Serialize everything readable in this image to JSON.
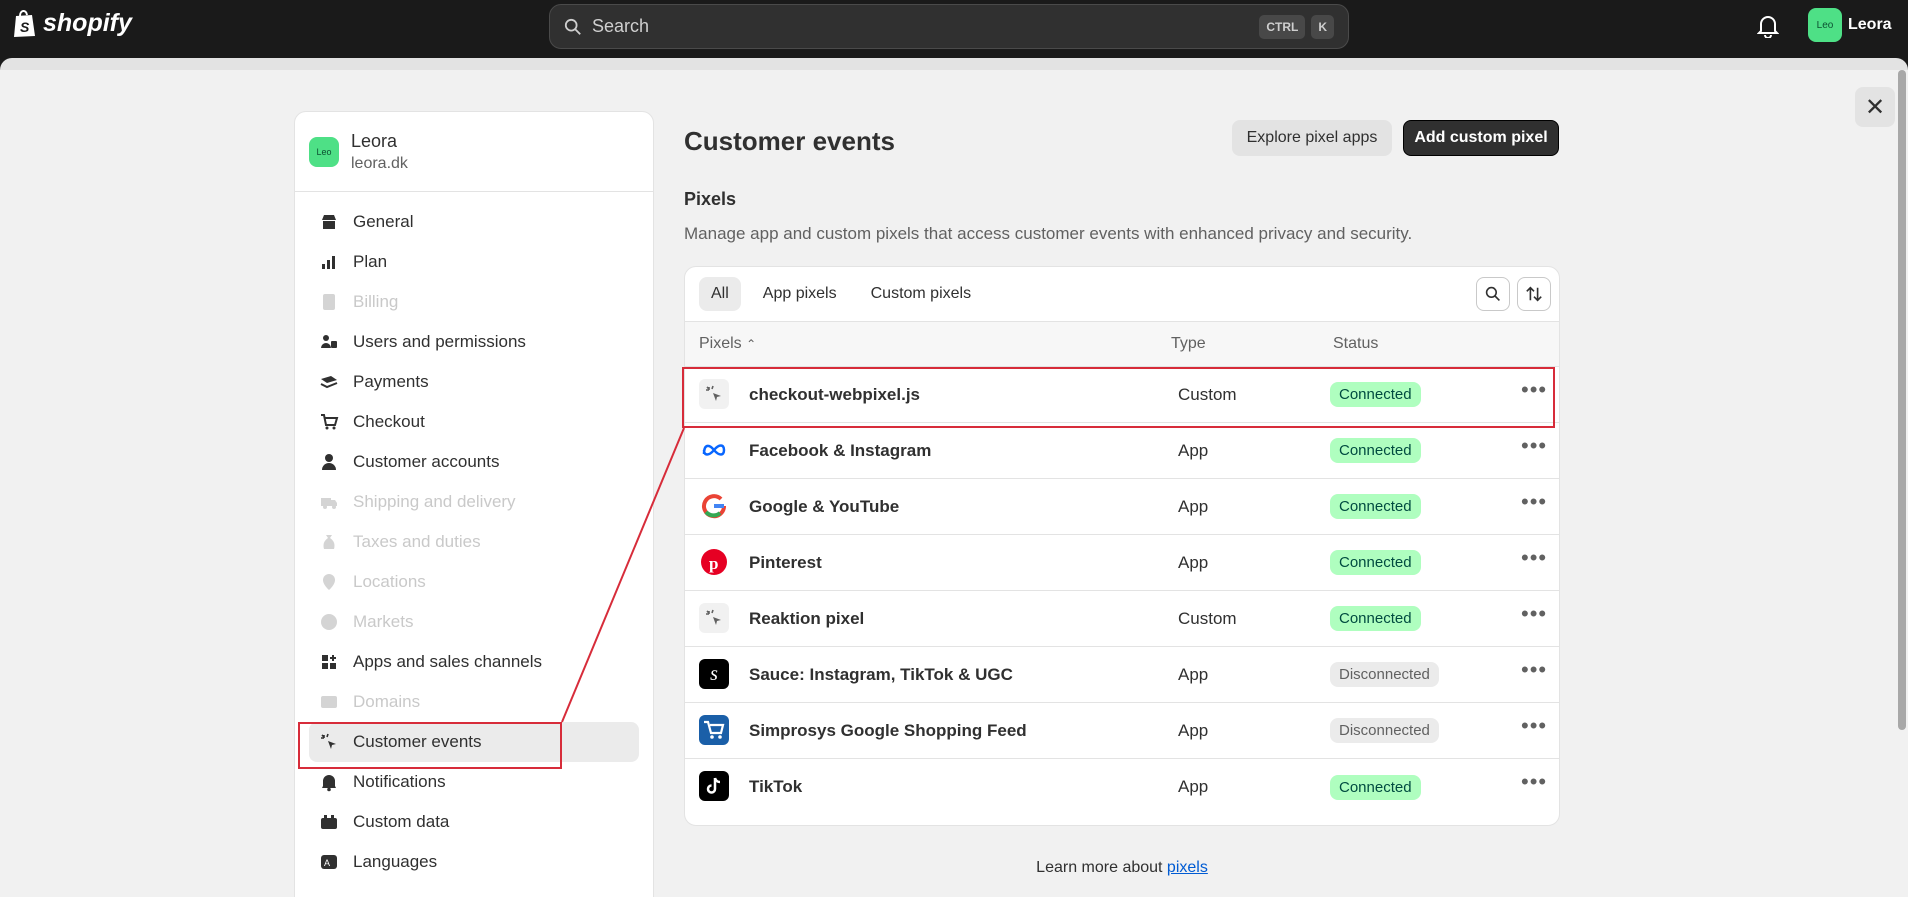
{
  "topbar": {
    "brand": "shopify",
    "search_placeholder": "Search",
    "shortcut_keys": [
      "CTRL",
      "K"
    ],
    "account_avatar": "Leo",
    "account_name": "Leora"
  },
  "sidebar": {
    "store_avatar": "Leo",
    "store_name": "Leora",
    "store_domain": "leora.dk",
    "items": [
      {
        "label": "General",
        "icon": "store-icon",
        "disabled": false
      },
      {
        "label": "Plan",
        "icon": "plan-icon",
        "disabled": false
      },
      {
        "label": "Billing",
        "icon": "billing-icon",
        "disabled": true
      },
      {
        "label": "Users and permissions",
        "icon": "users-icon",
        "disabled": false
      },
      {
        "label": "Payments",
        "icon": "payments-icon",
        "disabled": false
      },
      {
        "label": "Checkout",
        "icon": "cart-icon",
        "disabled": false
      },
      {
        "label": "Customer accounts",
        "icon": "person-icon",
        "disabled": false
      },
      {
        "label": "Shipping and delivery",
        "icon": "truck-icon",
        "disabled": true
      },
      {
        "label": "Taxes and duties",
        "icon": "tax-icon",
        "disabled": true
      },
      {
        "label": "Locations",
        "icon": "location-icon",
        "disabled": true
      },
      {
        "label": "Markets",
        "icon": "globe-icon",
        "disabled": true
      },
      {
        "label": "Apps and sales channels",
        "icon": "apps-icon",
        "disabled": false
      },
      {
        "label": "Domains",
        "icon": "domain-icon",
        "disabled": true
      },
      {
        "label": "Customer events",
        "icon": "cursor-icon",
        "disabled": false,
        "active": true
      },
      {
        "label": "Notifications",
        "icon": "bell-icon",
        "disabled": false
      },
      {
        "label": "Custom data",
        "icon": "data-icon",
        "disabled": false
      },
      {
        "label": "Languages",
        "icon": "language-icon",
        "disabled": false
      }
    ]
  },
  "main": {
    "title": "Customer events",
    "explore_button": "Explore pixel apps",
    "add_button": "Add custom pixel",
    "section_title": "Pixels",
    "section_desc": "Manage app and custom pixels that access customer events with enhanced privacy and security.",
    "tabs": [
      "All",
      "App pixels",
      "Custom pixels"
    ],
    "columns": {
      "pixels": "Pixels",
      "type": "Type",
      "status": "Status"
    },
    "rows": [
      {
        "name": "checkout-webpixel.js",
        "type": "Custom",
        "status": "Connected",
        "logo": "custom-pixel-icon"
      },
      {
        "name": "Facebook & Instagram",
        "type": "App",
        "status": "Connected",
        "logo": "meta-icon"
      },
      {
        "name": "Google & YouTube",
        "type": "App",
        "status": "Connected",
        "logo": "google-icon"
      },
      {
        "name": "Pinterest",
        "type": "App",
        "status": "Connected",
        "logo": "pinterest-icon"
      },
      {
        "name": "Reaktion pixel",
        "type": "Custom",
        "status": "Connected",
        "logo": "custom-pixel-icon"
      },
      {
        "name": "Sauce: Instagram, TikTok & UGC",
        "type": "App",
        "status": "Disconnected",
        "logo": "sauce-icon"
      },
      {
        "name": "Simprosys Google Shopping Feed",
        "type": "App",
        "status": "Disconnected",
        "logo": "cart-logo-icon"
      },
      {
        "name": "TikTok",
        "type": "App",
        "status": "Connected",
        "logo": "tiktok-icon"
      }
    ],
    "learn_prefix": "Learn more about ",
    "learn_link": "pixels"
  },
  "colors": {
    "connected": "#affebf",
    "disconnected": "#ebebeb",
    "highlight": "#d72c3a",
    "avatar": "#4ee086"
  }
}
